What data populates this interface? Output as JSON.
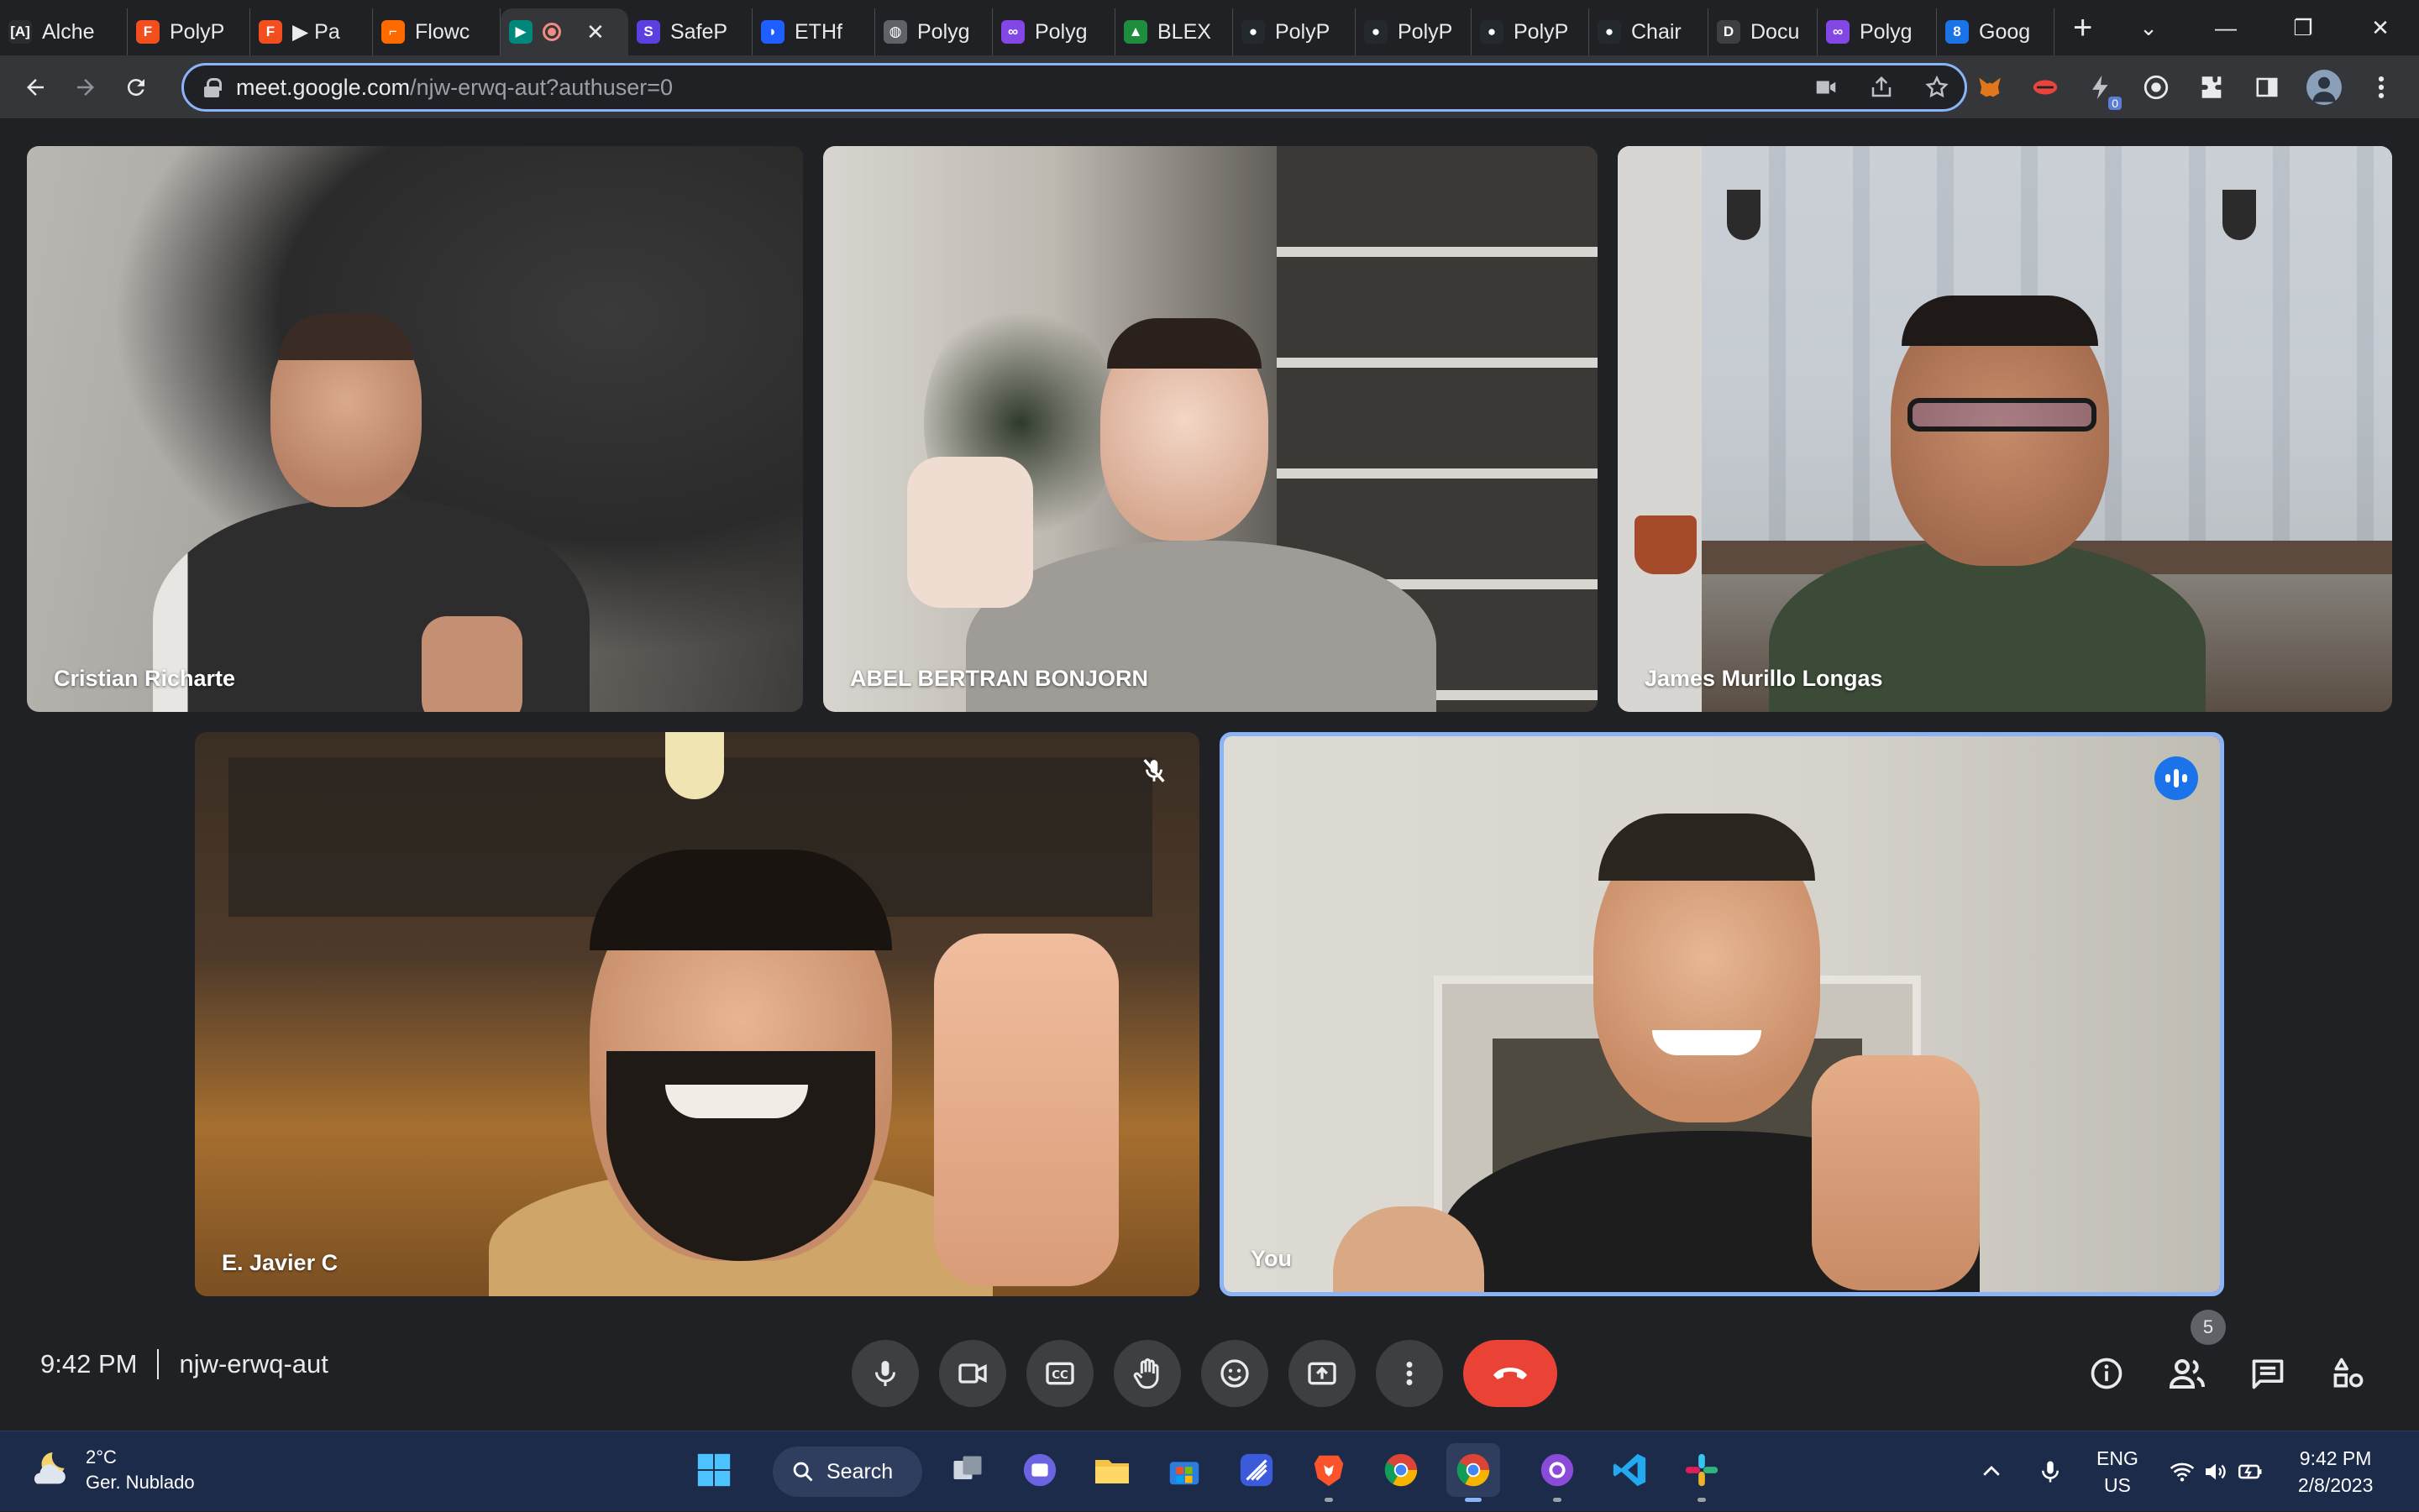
{
  "browser": {
    "tabs": [
      {
        "label": "Alche",
        "favicon": "alchemy-icon",
        "color": "#2b2d31",
        "glyph": "[A]"
      },
      {
        "label": "PolyP",
        "favicon": "figma-icon",
        "color": "#f24e1e",
        "glyph": "F"
      },
      {
        "label": "▶ Pa",
        "favicon": "figma-icon",
        "color": "#f24e1e",
        "glyph": "F"
      },
      {
        "label": "Flowc",
        "favicon": "flowchart-icon",
        "color": "#ff6a00",
        "glyph": "⌐"
      },
      {
        "label": "",
        "favicon": "google-meet-icon",
        "color": "#00897b",
        "glyph": "▶",
        "active": true,
        "recording": true
      },
      {
        "label": "SafeP",
        "favicon": "safe-icon",
        "color": "#5c3fe0",
        "glyph": "S"
      },
      {
        "label": "ETHf",
        "favicon": "ethf-icon",
        "color": "#1f5fff",
        "glyph": "◗"
      },
      {
        "label": "Polyg",
        "favicon": "globe-icon",
        "color": "#5f6368",
        "glyph": "◍"
      },
      {
        "label": "Polyg",
        "favicon": "polygon-icon",
        "color": "#8247e5",
        "glyph": "∞"
      },
      {
        "label": "BLEX",
        "favicon": "google-drive-icon",
        "color": "#1e8e3e",
        "glyph": "▲"
      },
      {
        "label": "PolyP",
        "favicon": "github-icon",
        "color": "#24292e",
        "glyph": "●"
      },
      {
        "label": "PolyP",
        "favicon": "github-icon",
        "color": "#24292e",
        "glyph": "●"
      },
      {
        "label": "PolyP",
        "favicon": "github-icon",
        "color": "#24292e",
        "glyph": "●"
      },
      {
        "label": "Chair",
        "favicon": "github-icon",
        "color": "#24292e",
        "glyph": "●"
      },
      {
        "label": "Docu",
        "favicon": "docs-icon",
        "color": "#3c4043",
        "glyph": "D"
      },
      {
        "label": "Polyg",
        "favicon": "polygon-icon",
        "color": "#8247e5",
        "glyph": "∞"
      },
      {
        "label": "Goog",
        "favicon": "google-calendar-icon",
        "color": "#1a73e8",
        "glyph": "8"
      }
    ],
    "new_tab": "+",
    "window_controls": {
      "list": "⌄",
      "minimize": "—",
      "restore": "❐",
      "close": "✕"
    },
    "url_host": "meet.google.com",
    "url_path": "/njw-erwq-aut?authuser=0",
    "ext_badge": "0"
  },
  "meeting": {
    "participants": [
      {
        "name": "Cristian Richarte"
      },
      {
        "name": "ABEL BERTRAN BONJORN"
      },
      {
        "name": "James Murillo Longas"
      },
      {
        "name": "E. Javier C",
        "muted": true
      },
      {
        "name": "You",
        "speaking": true
      }
    ],
    "time": "9:42 PM",
    "code": "njw-erwq-aut",
    "participant_count": "5",
    "colors": {
      "hangup": "#ea4335",
      "active_border": "#8ab4f8",
      "speaking": "#1a73e8"
    }
  },
  "taskbar": {
    "weather": {
      "temp": "2°C",
      "condition": "Ger. Nublado"
    },
    "search_label": "Search",
    "lang": {
      "line1": "ENG",
      "line2": "US"
    },
    "clock": {
      "time": "9:42 PM",
      "date": "2/8/2023"
    }
  }
}
